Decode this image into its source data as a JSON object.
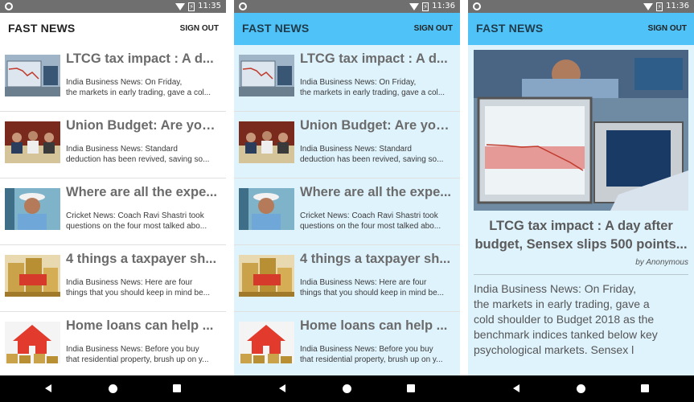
{
  "status_times": [
    "11:35",
    "11:36",
    "11:36"
  ],
  "app": {
    "title": "FAST NEWS",
    "signout_label": "SIGN OUT"
  },
  "colors": {
    "appbar_blue": "#4fc3f7",
    "background_blue": "#dff3fd",
    "status_bar": "#6f6f6f"
  },
  "articles": [
    {
      "title": "LTCG tax impact : A d...",
      "desc1": "India Business News: On Friday,",
      "desc2": "the markets in early trading, gave a col...",
      "thumb": "stock-chart-image"
    },
    {
      "title": "Union Budget: Are you...",
      "desc1": "India Business News: Standard",
      "desc2": "deduction has been revived, saving so...",
      "thumb": "budget-meeting-image"
    },
    {
      "title": "Where are all the expe...",
      "desc1": "Cricket News: Coach Ravi Shastri took",
      "desc2": "questions on the four most talked abo...",
      "thumb": "cricket-coach-image"
    },
    {
      "title": "4 things a taxpayer sh...",
      "desc1": "India Business News: Here are four",
      "desc2": "things that you should keep in mind be...",
      "thumb": "coins-tax-image"
    },
    {
      "title": "Home loans can help ...",
      "desc1": "India Business News: Before you buy",
      "desc2": "that residential property, brush up on y...",
      "thumb": "house-coins-image"
    }
  ],
  "detail": {
    "title_line1": "LTCG tax impact : A day after",
    "title_line2": "budget, Sensex slips 500 points...",
    "author": "by Anonymous",
    "body": [
      "India Business News: On Friday,",
      "the markets in early trading, gave a",
      "cold shoulder to Budget 2018 as the",
      "benchmark indices tanked below key",
      "psychological markets. Sensex l"
    ]
  }
}
